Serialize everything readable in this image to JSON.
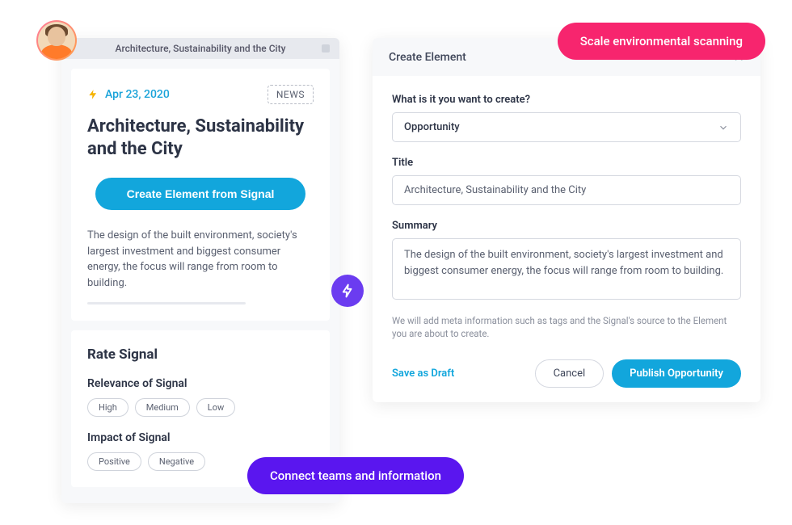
{
  "floating": {
    "pink_pill": "Scale environmental scanning",
    "purple_pill": "Connect teams and information"
  },
  "left": {
    "header_title": "Architecture, Sustainability and the City",
    "signal": {
      "date": "Apr 23, 2020",
      "tag": "NEWS",
      "title": "Architecture, Sustainability and the City",
      "create_button": "Create Element from Signal",
      "description": "The design of the built environment, society's largest investment and biggest consumer energy, the focus will range from room to building."
    },
    "rate": {
      "heading": "Rate Signal",
      "relevance_label": "Relevance of Signal",
      "relevance_options": [
        "High",
        "Medium",
        "Low"
      ],
      "impact_label": "Impact of Signal",
      "impact_options": [
        "Positive",
        "Negative"
      ]
    }
  },
  "right": {
    "header_title": "Create Element",
    "q_label": "What is it you want to create?",
    "type_selected": "Opportunity",
    "title_label": "Title",
    "title_value": "Architecture, Sustainability and the City",
    "summary_label": "Summary",
    "summary_value": "The design of the built environment, society's largest investment and biggest consumer energy, the focus will range from room to building.",
    "meta_note": "We will add meta information such as tags and the Signal's source to the Element you are about to create.",
    "save_draft": "Save as Draft",
    "cancel": "Cancel",
    "publish": "Publish Opportunity"
  }
}
